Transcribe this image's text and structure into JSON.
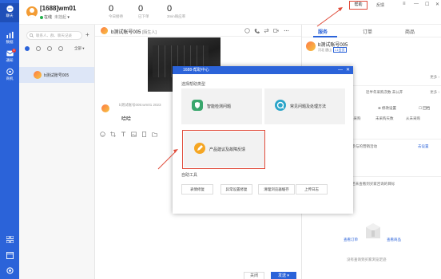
{
  "rail": {
    "items": [
      {
        "label": "聊天",
        "icon": "chat-icon"
      },
      {
        "label": "数据",
        "icon": "data-icon"
      },
      {
        "label": "通知",
        "icon": "bell-icon",
        "badge": "1"
      },
      {
        "label": "商机",
        "icon": "opportunity-icon"
      }
    ],
    "bottom_icons": [
      "apps-grid-icon",
      "window-icon",
      "settings-icon"
    ]
  },
  "header": {
    "account_name": "[1688]wm01",
    "status": "在线",
    "status_extra": "未挂起",
    "stats": [
      {
        "value": "0",
        "caption": "今日接待"
      },
      {
        "value": "0",
        "caption": "已下单"
      },
      {
        "value": "0",
        "caption": "3min响应率"
      }
    ],
    "help_label": "帮助",
    "settings_label": "反馈"
  },
  "contacts": {
    "search_placeholder": "联系人、群、聊天记录",
    "add_label": "+",
    "filter_all": "全部",
    "items": [
      {
        "name": "b测试账号005"
      }
    ]
  },
  "chat": {
    "contact_name": "b测试账号005",
    "contact_tag": "[陌生人]",
    "message_meta": "b测试账号005:wm01 2023",
    "message_text": "哈哈",
    "close_label": "关闭",
    "send_label": "发送"
  },
  "right_panel": {
    "tabs": [
      "服务",
      "订单",
      "商品"
    ],
    "name": "b测试账号005",
    "sub": "河北 唐山",
    "member_tag": "L1会员",
    "more": "更多",
    "line1": "近半年采购次数 未公开",
    "more2": "更多",
    "tag_manage": "⊕ 修改设置",
    "tag_edit": "☐ 回档",
    "line2a": "未采购",
    "line2b": "未采购天数",
    "line2c": "从未采购",
    "line3": "可参与的营销活动",
    "line3_link": "去设置",
    "line4": "ⓘ 你还未查看到买家咨询的目标",
    "link_orders": "查看订单",
    "link_goods": "查看商品",
    "empty_text": "没有查询到买家浏览足迹"
  },
  "dialog": {
    "title": "1688-帮助中心",
    "subtitle": "选择帮助类型",
    "cards": [
      {
        "label": "智能检测问题",
        "color": "#3aa76d",
        "icon": "shield-icon"
      },
      {
        "label": "常见问题及处理方法",
        "color": "#2aa4c9",
        "icon": "question-icon"
      },
      {
        "label": "产品建议及故障反馈",
        "color": "#f5a623",
        "icon": "pencil-icon"
      }
    ],
    "tools_label": "自助工具",
    "tools": [
      "表情修复",
      "异常设置修复",
      "清理浏览器缓存",
      "上传日志"
    ]
  },
  "colors": {
    "accent": "#2b63d9",
    "highlight": "#e04b3a"
  }
}
